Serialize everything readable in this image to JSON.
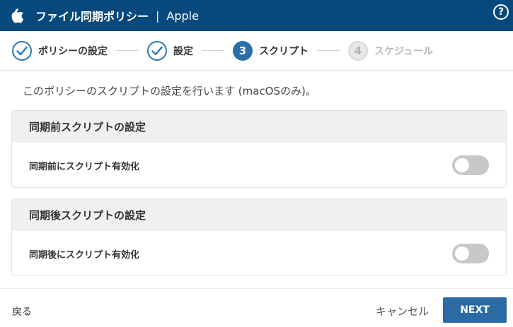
{
  "header": {
    "title": "ファイル同期ポリシー",
    "separator": "|",
    "subtitle": "Apple",
    "help_icon": "question-circle-icon",
    "help_glyph": "?",
    "logo_icon": "apple-icon",
    "bg_color": "#07497d"
  },
  "stepper": {
    "steps": [
      {
        "number": "1",
        "label": "ポリシーの設定",
        "status": "done"
      },
      {
        "number": "2",
        "label": "設定",
        "status": "done"
      },
      {
        "number": "3",
        "label": "スクリプト",
        "status": "active"
      },
      {
        "number": "4",
        "label": "スケジュール",
        "status": "todo"
      }
    ],
    "accent_color": "#2a6fa8"
  },
  "intro_text": "このポリシーのスクリプトの設定を行います (macOSのみ)。",
  "sections": [
    {
      "title": "同期前スクリプトの設定",
      "toggle_label": "同期前にスクリプト有効化",
      "enabled": false
    },
    {
      "title": "同期後スクリプトの設定",
      "toggle_label": "同期後にスクリプト有効化",
      "enabled": false
    }
  ],
  "footer": {
    "back_label": "戻る",
    "cancel_label": "キャンセル",
    "next_label": "NEXT",
    "next_color": "#2b6aa2"
  }
}
